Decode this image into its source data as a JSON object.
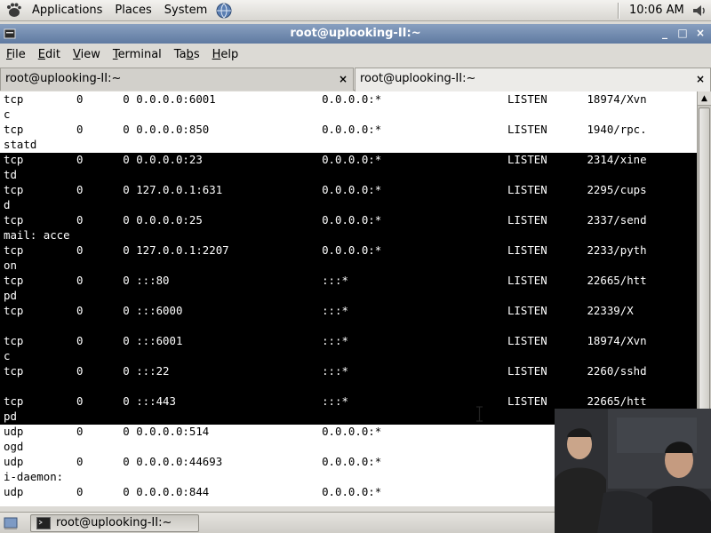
{
  "top_panel": {
    "menus": [
      "Applications",
      "Places",
      "System"
    ],
    "clock": "10:06 AM"
  },
  "window": {
    "title": "root@uplooking-II:~",
    "menus": [
      {
        "label": "File",
        "mnemonic": "F",
        "rest": "ile"
      },
      {
        "label": "Edit",
        "mnemonic": "E",
        "rest": "dit"
      },
      {
        "label": "View",
        "mnemonic": "V",
        "rest": "iew"
      },
      {
        "label": "Terminal",
        "mnemonic": "T",
        "rest": "erminal"
      },
      {
        "label": "Tabs",
        "mnemonic": "b",
        "pre": "Ta",
        "rest": "s"
      },
      {
        "label": "Help",
        "mnemonic": "H",
        "rest": "elp"
      }
    ],
    "tabs": [
      {
        "label": "root@uplooking-II:~",
        "active": false
      },
      {
        "label": "root@uplooking-II:~",
        "active": true
      }
    ]
  },
  "terminal": {
    "lines": [
      "tcp        0      0 0.0.0.0:6001                0.0.0.0:*                   LISTEN      18974/Xvn",
      "c",
      "tcp        0      0 0.0.0.0:850                 0.0.0.0:*                   LISTEN      1940/rpc.",
      "statd",
      "tcp        0      0 0.0.0.0:23                  0.0.0.0:*                   LISTEN      2314/xine",
      "td",
      "tcp        0      0 127.0.0.1:631               0.0.0.0:*                   LISTEN      2295/cups",
      "d",
      "tcp        0      0 0.0.0.0:25                  0.0.0.0:*                   LISTEN      2337/send",
      "mail: acce",
      "tcp        0      0 127.0.0.1:2207              0.0.0.0:*                   LISTEN      2233/pyth",
      "on",
      "tcp        0      0 :::80                       :::*                        LISTEN      22665/htt",
      "pd",
      "tcp        0      0 :::6000                     :::*                        LISTEN      22339/X",
      "",
      "tcp        0      0 :::6001                     :::*                        LISTEN      18974/Xvn",
      "c",
      "tcp        0      0 :::22                       :::*                        LISTEN      2260/sshd",
      "",
      "tcp        0      0 :::443                      :::*                        LISTEN      22665/htt",
      "pd",
      "udp        0      0 0.0.0.0:514                 0.0.0.0:*",
      "ogd",
      "udp        0      0 0.0.0.0:44693               0.0.0.0:*",
      "i-daemon:",
      "udp        0      0 0.0.0.0:844                 0.0.0.0:*"
    ],
    "selected_from": 4,
    "selected_to": 21
  },
  "taskbar": {
    "task_label": "root@uplooking-II:~"
  },
  "colors": {
    "titlebar": "#6f88ad",
    "selection": "#000000",
    "terminal_bg": "#ffffff"
  }
}
